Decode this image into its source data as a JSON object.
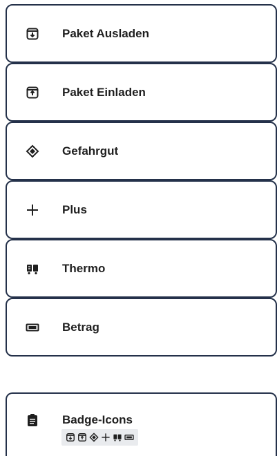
{
  "items": [
    {
      "label": "Paket Ausladen",
      "icon": "package-unload-icon"
    },
    {
      "label": "Paket Einladen",
      "icon": "package-load-icon"
    },
    {
      "label": "Gefahrgut",
      "icon": "hazard-diamond-icon"
    },
    {
      "label": "Plus",
      "icon": "plus-icon"
    },
    {
      "label": "Thermo",
      "icon": "thermo-truck-icon"
    },
    {
      "label": "Betrag",
      "icon": "amount-icon"
    }
  ],
  "badge": {
    "label": "Badge-Icons",
    "icon": "clipboard-icon",
    "mini_icons": [
      "package-unload-icon",
      "package-load-icon",
      "hazard-diamond-icon",
      "plus-icon",
      "thermo-truck-icon",
      "amount-icon"
    ]
  },
  "colors": {
    "border": "#24314a",
    "text": "#1f1f1f",
    "badge_strip": "#e9ebee"
  }
}
